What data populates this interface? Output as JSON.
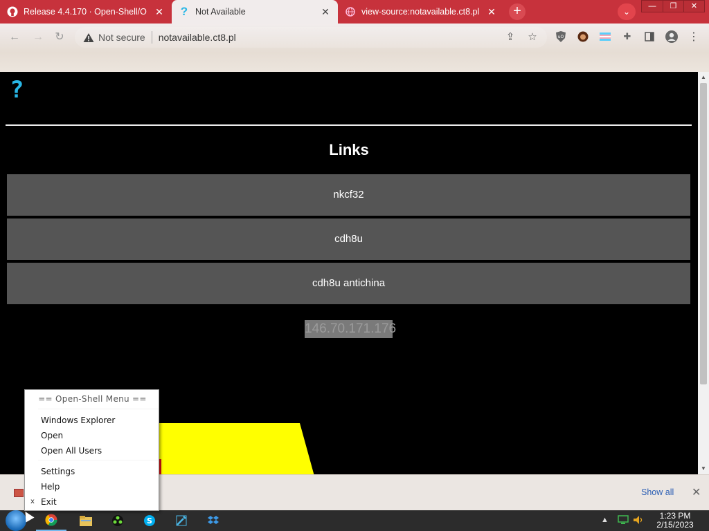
{
  "browser": {
    "tabs": [
      {
        "label": "Release 4.4.170 · Open-Shell/O",
        "icon": "github-icon"
      },
      {
        "label": "Not Available",
        "icon": "question-icon"
      },
      {
        "label": "view-source:notavailable.ct8.pl",
        "icon": "globe-icon"
      }
    ],
    "new_tab": "+",
    "tab_search": "⌄",
    "window_controls": {
      "minimize": "—",
      "restore": "❐",
      "close": "✕"
    },
    "omnibox": {
      "security_label": "Not secure",
      "url": "notavailable.ct8.pl"
    }
  },
  "page": {
    "logo": "?",
    "heading": "Links",
    "links": [
      "nkcf32",
      "cdh8u",
      "cdh8u antichina"
    ],
    "ip_address": "146.70.171.176"
  },
  "download_bar": {
    "show_all": "Show all",
    "close": "✕"
  },
  "taskbar": {
    "clock_time": "1:23 PM",
    "clock_date": "2/15/2023"
  },
  "context_menu": {
    "title": "== Open-Shell Menu ==",
    "items": [
      "Windows Explorer",
      "Open",
      "Open All Users",
      "Settings",
      "Help",
      "Exit"
    ],
    "exit_mark": "x"
  },
  "colors": {
    "tab_strip": "#c7323c",
    "page_bg": "#000000",
    "link_button": "#555555",
    "logo": "#29b7e6",
    "highlight_shape": "#ffff00"
  }
}
